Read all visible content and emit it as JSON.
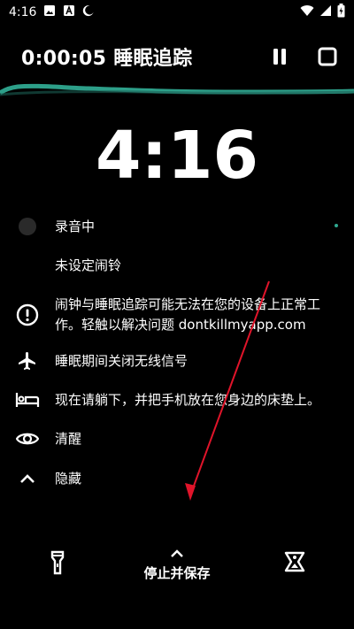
{
  "status_bar": {
    "time": "4:16"
  },
  "header": {
    "title": "0:00:05 睡眠追踪"
  },
  "clock": {
    "time": "4:16"
  },
  "rows": [
    {
      "icon": "record-dot-icon",
      "text": "录音中"
    },
    {
      "icon": "",
      "text": "未设定闹铃"
    },
    {
      "icon": "info-circle-icon",
      "text": "闹钟与睡眠追踪可能无法在您的设备上正常工作。轻触以解决问题 dontkillmyapp.com"
    },
    {
      "icon": "airplane-icon",
      "text": "睡眠期间关闭无线信号"
    },
    {
      "icon": "bed-icon",
      "text": "现在请躺下，并把手机放在您身边的床垫上。"
    },
    {
      "icon": "eye-icon",
      "text": "清醒"
    },
    {
      "icon": "chevron-up-icon",
      "text": "隐藏"
    }
  ],
  "bottom": {
    "stop_save_label": "停止并保存"
  },
  "colors": {
    "accent": "#2fa890",
    "arrow": "#e0142a"
  }
}
